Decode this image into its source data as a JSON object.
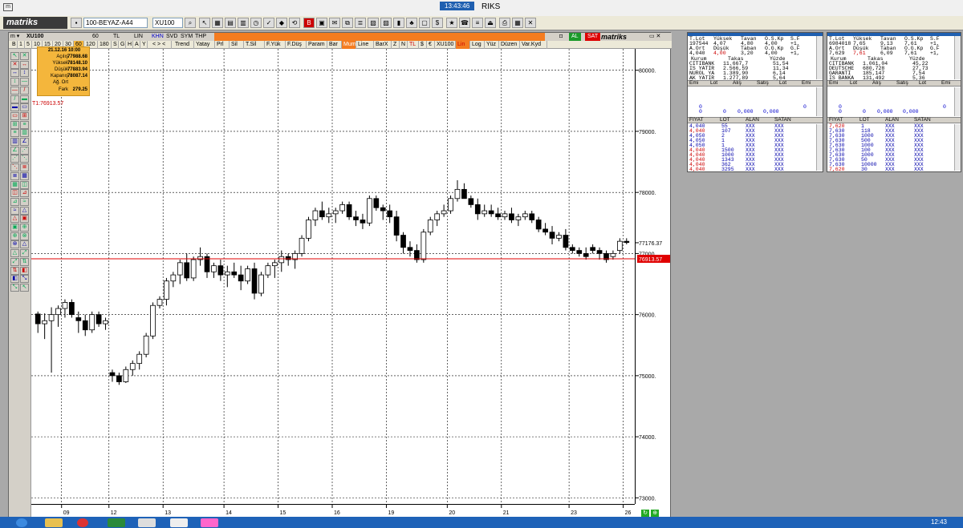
{
  "window": {
    "title": "RIKS",
    "clock": "13:43:46"
  },
  "toolbar": {
    "workspace": "100-BEYAZ-A44",
    "symbol": "XU100"
  },
  "chart_header": {
    "symbol": "XU100",
    "row1": [
      "60",
      "TL",
      "LIN",
      "KHN",
      "SVD",
      "SYM",
      "THP"
    ],
    "periods": [
      "B",
      "1",
      "5",
      "10",
      "15",
      "20",
      "30",
      "60",
      "120",
      "180",
      "S",
      "G",
      "H",
      "A",
      "Y"
    ],
    "tools": [
      "Trend",
      "Yatay",
      "Prl",
      "Sil",
      "T.Sil",
      "F.Yük",
      "F.Düş",
      "Param",
      "Bar",
      "Mum",
      "Line",
      "BarX",
      "Z",
      "N",
      "TL",
      "$",
      "€",
      "XU100",
      "Lin",
      "Log",
      "Yüz",
      "Düzen",
      "Var.Kyd"
    ],
    "badges": [
      "AL",
      "SAT"
    ],
    "brand": "matriks"
  },
  "infobox": {
    "datetime": "21.12.16 10:00",
    "rows": [
      {
        "k": "Açılış",
        "v": "77988.68"
      },
      {
        "k": "Yüksek",
        "v": "78148.10"
      },
      {
        "k": "Düşük",
        "v": "77883.94"
      },
      {
        "k": "Kapanış",
        "v": "78087.14"
      },
      {
        "k": "Ağ. Ort",
        "v": ""
      },
      {
        "k": "Fark",
        "v": "279.25"
      }
    ],
    "t1": "T1:76913.57"
  },
  "chart_data": {
    "type": "candlestick",
    "y_ticks": [
      "80000.",
      "79000.",
      "78000.",
      "77000.",
      "76000.",
      "75000.",
      "74000.",
      "73000."
    ],
    "ylim": [
      72900,
      80350
    ],
    "x_ticks": [
      "09",
      "12",
      "13",
      "14",
      "15",
      "16",
      "19",
      "20",
      "21",
      "23",
      "26"
    ],
    "last_price": "77176.37",
    "hline": {
      "value": 76913.57,
      "label": "76913.57",
      "color": "#e00000"
    },
    "candles": [
      [
        76010,
        76050,
        75700,
        75850
      ],
      [
        75850,
        76020,
        75600,
        75900
      ],
      [
        75900,
        76120,
        75050,
        76000
      ],
      [
        76000,
        76150,
        75800,
        76100
      ],
      [
        76100,
        76250,
        75950,
        76200
      ],
      [
        76200,
        76250,
        75950,
        76000
      ],
      [
        75950,
        76050,
        75700,
        75900
      ],
      [
        75900,
        76000,
        75650,
        75750
      ],
      [
        75750,
        76050,
        75700,
        76000
      ],
      [
        76000,
        76050,
        75800,
        75850
      ],
      [
        75850,
        75950,
        75750,
        75900
      ],
      [
        75050,
        75100,
        74900,
        75000
      ],
      [
        75000,
        75050,
        74850,
        74900
      ],
      [
        74900,
        75150,
        74880,
        75100
      ],
      [
        75100,
        75250,
        75000,
        75200
      ],
      [
        75200,
        75400,
        75100,
        75350
      ],
      [
        75350,
        75700,
        75300,
        75650
      ],
      [
        75650,
        76200,
        75600,
        76150
      ],
      [
        76150,
        76300,
        76100,
        76250
      ],
      [
        76250,
        76600,
        76150,
        76550
      ],
      [
        76550,
        76700,
        76450,
        76650
      ],
      [
        76650,
        76900,
        76500,
        76850
      ],
      [
        76850,
        77000,
        76550,
        76600
      ],
      [
        76600,
        76950,
        76550,
        76900
      ],
      [
        76900,
        77100,
        76800,
        76950
      ],
      [
        76950,
        77000,
        76600,
        76700
      ],
      [
        76700,
        76850,
        76600,
        76800
      ],
      [
        76800,
        76900,
        76550,
        76650
      ],
      [
        76650,
        76800,
        76450,
        76700
      ],
      [
        76700,
        76850,
        76600,
        76650
      ],
      [
        76650,
        76800,
        76400,
        76550
      ],
      [
        76550,
        76800,
        76500,
        76750
      ],
      [
        76750,
        76850,
        76250,
        76350
      ],
      [
        76350,
        76700,
        76300,
        76650
      ],
      [
        76650,
        76850,
        76600,
        76800
      ],
      [
        76800,
        76900,
        76600,
        76850
      ],
      [
        76850,
        77050,
        76700,
        76950
      ],
      [
        76950,
        77000,
        76800,
        76900
      ],
      [
        76900,
        77050,
        76750,
        77000
      ],
      [
        77000,
        77300,
        76950,
        77250
      ],
      [
        77250,
        77600,
        77200,
        77550
      ],
      [
        77550,
        77750,
        77450,
        77700
      ],
      [
        77700,
        77850,
        77550,
        77600
      ],
      [
        77600,
        77750,
        77500,
        77650
      ],
      [
        77650,
        77750,
        77500,
        77700
      ],
      [
        77700,
        77850,
        77650,
        77800
      ],
      [
        77800,
        77850,
        77550,
        77600
      ],
      [
        77600,
        77700,
        77450,
        77550
      ],
      [
        77550,
        77650,
        77400,
        77500
      ],
      [
        77500,
        77950,
        77450,
        77900
      ],
      [
        77900,
        77950,
        77700,
        77750
      ],
      [
        77750,
        77800,
        77550,
        77700
      ],
      [
        77700,
        77800,
        77500,
        77600
      ],
      [
        77600,
        77700,
        77200,
        77300
      ],
      [
        77300,
        77350,
        77000,
        77100
      ],
      [
        77100,
        77200,
        76950,
        77050
      ],
      [
        77050,
        77150,
        76850,
        76900
      ],
      [
        76900,
        77400,
        76850,
        77350
      ],
      [
        77350,
        77600,
        77300,
        77550
      ],
      [
        77550,
        77700,
        77450,
        77650
      ],
      [
        77650,
        77800,
        77600,
        77700
      ],
      [
        77700,
        77950,
        77650,
        77900
      ],
      [
        77900,
        78200,
        77850,
        78050
      ],
      [
        78050,
        78150,
        77900,
        77900
      ],
      [
        77900,
        77950,
        77750,
        77800
      ],
      [
        77800,
        77900,
        77550,
        77650
      ],
      [
        77650,
        77800,
        77600,
        77700
      ],
      [
        77700,
        77800,
        77600,
        77650
      ],
      [
        77650,
        77750,
        77550,
        77600
      ],
      [
        77600,
        77700,
        77550,
        77650
      ],
      [
        77650,
        77750,
        77500,
        77550
      ],
      [
        77550,
        77650,
        77450,
        77600
      ],
      [
        77600,
        77700,
        77550,
        77650
      ],
      [
        77650,
        77700,
        77500,
        77550
      ],
      [
        77550,
        77600,
        77350,
        77400
      ],
      [
        77400,
        77500,
        77300,
        77350
      ],
      [
        77350,
        77450,
        77150,
        77250
      ],
      [
        77250,
        77350,
        77200,
        77300
      ],
      [
        77300,
        77400,
        77050,
        77100
      ],
      [
        77100,
        77150,
        77000,
        77050
      ],
      [
        77050,
        77100,
        76950,
        77000
      ],
      [
        77000,
        77100,
        76900,
        76950
      ],
      [
        77100,
        77150,
        77000,
        77050
      ],
      [
        77050,
        77100,
        76900,
        77000
      ],
      [
        77000,
        77050,
        76850,
        76900
      ],
      [
        76950,
        77050,
        76900,
        77000
      ],
      [
        77050,
        77250,
        77000,
        77200
      ],
      [
        77200,
        77250,
        77150,
        77180
      ]
    ]
  },
  "panel_left": {
    "title": "NOGYO Farkı: +1,00  Fark: %",
    "top_header": [
      "T.Lot",
      "Yüksek",
      "Tavan",
      "O.S.Kp",
      "S.F"
    ],
    "top_row1": [
      "197544",
      "4,07",
      "4,80",
      "4,00",
      "+1,"
    ],
    "top_header2": [
      "A.Ort",
      "Düşük",
      "Taban",
      "O.G.Kp",
      "G.F"
    ],
    "top_row2": [
      "4,040",
      "4,00",
      "3,20",
      "4,00",
      "+1,"
    ],
    "kurum_header": [
      "Kurum",
      "Takas",
      "Yüzde"
    ],
    "kurum": [
      [
        "CITIBANK",
        "11.667,7",
        "51,54"
      ],
      [
        "IS YATIR",
        "2.566,59",
        "11,34"
      ],
      [
        "NUROL YA",
        "1.389,90",
        "6,14"
      ],
      [
        "AK YATIR",
        "1.277,89",
        "5,64"
      ]
    ],
    "depth_header": [
      "Emi",
      "Lot",
      "Alış",
      "Satış",
      "Lot",
      "Emi"
    ],
    "depth_row": [
      "0",
      "0",
      "0,000",
      "0,000",
      "0",
      "0"
    ],
    "trades_header": [
      "FIYAT",
      "LOT",
      "ALAN",
      "SATAN"
    ],
    "trades": [
      [
        "4,040",
        "55",
        "XXX",
        "XXX"
      ],
      [
        "4,040",
        "107",
        "XXX",
        "XXX"
      ],
      [
        "4,050",
        "2",
        "XXX",
        "XXX"
      ],
      [
        "4,050",
        "1",
        "XXX",
        "XXX"
      ],
      [
        "4,050",
        "1",
        "XXX",
        "XXX"
      ],
      [
        "4,040",
        "1500",
        "XXX",
        "XXX"
      ],
      [
        "4,040",
        "1000",
        "XXX",
        "XXX"
      ],
      [
        "4,040",
        "1343",
        "XXX",
        "XXX"
      ],
      [
        "4,040",
        "362",
        "XXX",
        "XXX"
      ],
      [
        "4,040",
        "3295",
        "XXX",
        "XXX"
      ]
    ]
  },
  "panel_right": {
    "title": "GARAN Farkı: -0,05  Fark: %",
    "top_header": [
      "T.Lot",
      "Yüksek",
      "Tavan",
      "O.S.Kp",
      "S.F"
    ],
    "top_row1": [
      "6984018",
      "7,65",
      "9,13",
      "7,61",
      "+1,"
    ],
    "top_header2": [
      "A.Ort",
      "Düşük",
      "Taban",
      "O.G.Kp",
      "G.F"
    ],
    "top_row2": [
      "7,629",
      "7,61",
      "6,09",
      "7,61",
      "+1,"
    ],
    "kurum_header": [
      "Kurum",
      "Takas",
      "Yüzde"
    ],
    "kurum": [
      [
        "CITIBANK",
        "1.061,04",
        "45,22"
      ],
      [
        "DEUTSCHE",
        "680,728",
        "27,73"
      ],
      [
        "GARANTI",
        "185,147",
        "7,54"
      ],
      [
        "IS BANKA",
        "131,492",
        "5,36"
      ]
    ],
    "depth_header": [
      "Emi",
      "Lot",
      "Alış",
      "Satış",
      "Lot",
      "Emi"
    ],
    "depth_row": [
      "0",
      "0",
      "0,000",
      "0,000",
      "0",
      "0"
    ],
    "trades_header": [
      "FIYAT",
      "LOT",
      "ALAN",
      "SATAN"
    ],
    "trades": [
      [
        "7,620",
        "1",
        "XXX",
        "XXX"
      ],
      [
        "7,630",
        "118",
        "XXX",
        "XXX"
      ],
      [
        "7,630",
        "1000",
        "XXX",
        "XXX"
      ],
      [
        "7,630",
        "500",
        "XXX",
        "XXX"
      ],
      [
        "7,630",
        "1000",
        "XXX",
        "XXX"
      ],
      [
        "7,630",
        "100",
        "XXX",
        "XXX"
      ],
      [
        "7,630",
        "1000",
        "XXX",
        "XXX"
      ],
      [
        "7,630",
        "50",
        "XXX",
        "XXX"
      ],
      [
        "7,630",
        "10000",
        "XXX",
        "XXX"
      ],
      [
        "7,620",
        "30",
        "XXX",
        "XXX"
      ]
    ]
  },
  "taskbar": {
    "time": "12:43"
  }
}
